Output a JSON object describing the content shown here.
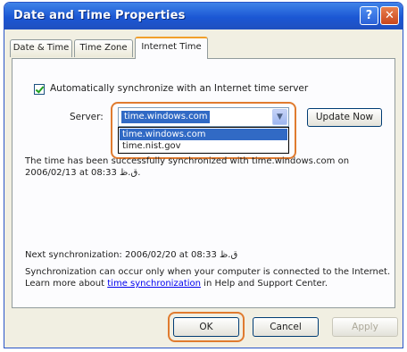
{
  "window": {
    "title": "Date and Time Properties",
    "help_glyph": "?",
    "close_glyph": "✕"
  },
  "tabs": [
    {
      "label": "Date & Time"
    },
    {
      "label": "Time Zone"
    },
    {
      "label": "Internet Time"
    }
  ],
  "internet_time": {
    "auto_sync_label": "Automatically synchronize with an Internet time server",
    "auto_sync_checked": true,
    "server_label": "Server:",
    "server_value": "time.windows.com",
    "server_options": [
      "time.windows.com",
      "time.nist.gov"
    ],
    "update_now_label": "Update Now",
    "status_text": "The time has been successfully synchronized with time.windows.com on 2006/02/13 at 08:33 ق.ظ.",
    "next_sync_text": "Next synchronization: 2006/02/20 at 08:33 ق.ظ",
    "info_before": "Synchronization can occur only when your computer is connected to the Internet.  Learn more about ",
    "info_link": "time synchronization",
    "info_after": " in Help and Support Center."
  },
  "buttons": {
    "ok": "OK",
    "cancel": "Cancel",
    "apply": "Apply"
  },
  "colors": {
    "titlebar": "#1b57d4",
    "highlight": "#316ac5",
    "annotation": "#e07b2f"
  }
}
